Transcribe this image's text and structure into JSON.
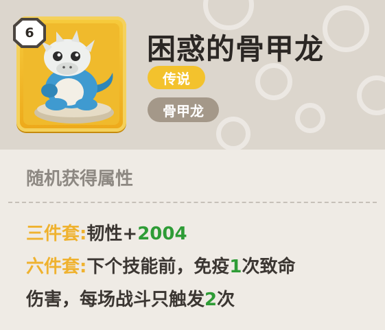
{
  "item": {
    "level": "6",
    "name": "困惑的骨甲龙",
    "rarity": "传说",
    "species": "骨甲龙"
  },
  "attributes": {
    "section_title": "随机获得属性",
    "set3": {
      "label": "三件套:",
      "stat": "韧性+",
      "value": "2004"
    },
    "set6": {
      "label": "六件套:",
      "text_a": "下个技能前，免疫",
      "value_a": "1",
      "text_b": "次致命",
      "text_c": "伤害，每场战斗只触发",
      "value_b": "2",
      "text_d": "次"
    }
  },
  "colors": {
    "rarity_legendary": "#f3c22d",
    "effect_label": "#efb22f",
    "effect_value": "#2e9c36",
    "species_tag": "#a49889"
  },
  "icons": {
    "creature": "bone-armor-dragon-portrait"
  }
}
